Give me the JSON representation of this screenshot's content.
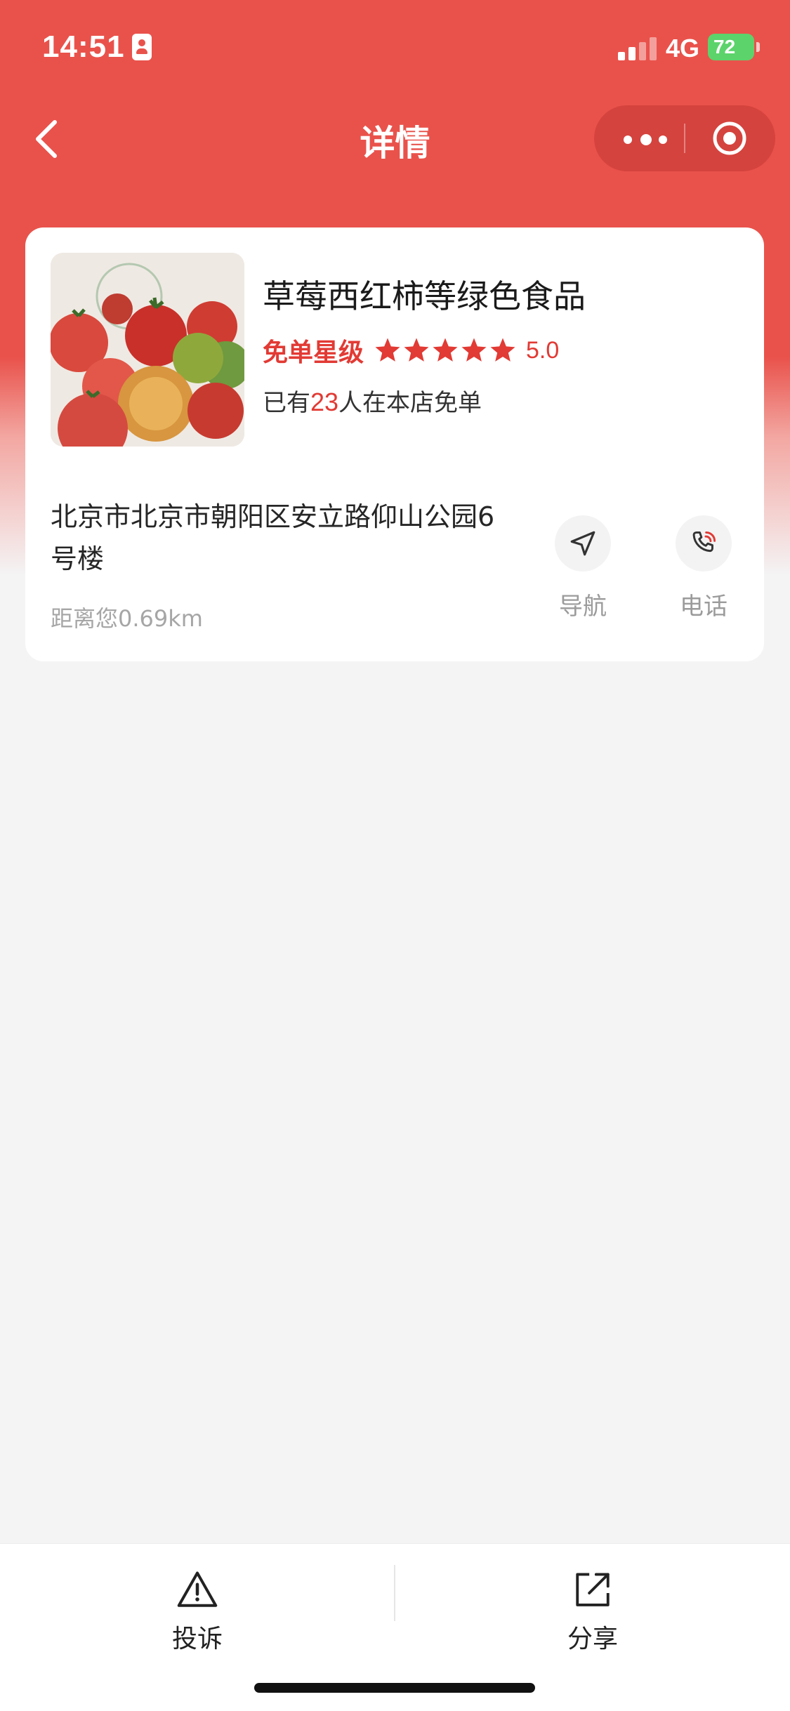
{
  "status_bar": {
    "time": "14:51",
    "network": "4G",
    "battery": "72"
  },
  "nav": {
    "title": "详情",
    "back_icon": "chevron-left-icon",
    "more_icon": "more-dots-icon",
    "close_icon": "target-close-icon"
  },
  "shop": {
    "name": "草莓西红柿等绿色食品",
    "rating_label": "免单星级",
    "rating_value": "5.0",
    "rating_stars": 5,
    "count_prefix": "已有",
    "count": "23",
    "count_suffix": "人在本店免单",
    "address": "北京市北京市朝阳区安立路仰山公园6号楼",
    "distance": "距离您0.69km",
    "image_icon": "tomatoes-photo"
  },
  "actions": {
    "navigate": {
      "label": "导航",
      "icon": "navigation-arrow-icon"
    },
    "call": {
      "label": "电话",
      "icon": "phone-icon"
    }
  },
  "bottom": {
    "complain": {
      "label": "投诉",
      "icon": "warning-triangle-icon"
    },
    "share": {
      "label": "分享",
      "icon": "share-icon"
    }
  },
  "colors": {
    "brand": "#e9524b",
    "accent": "#e23a34",
    "background": "#f4f4f5"
  }
}
